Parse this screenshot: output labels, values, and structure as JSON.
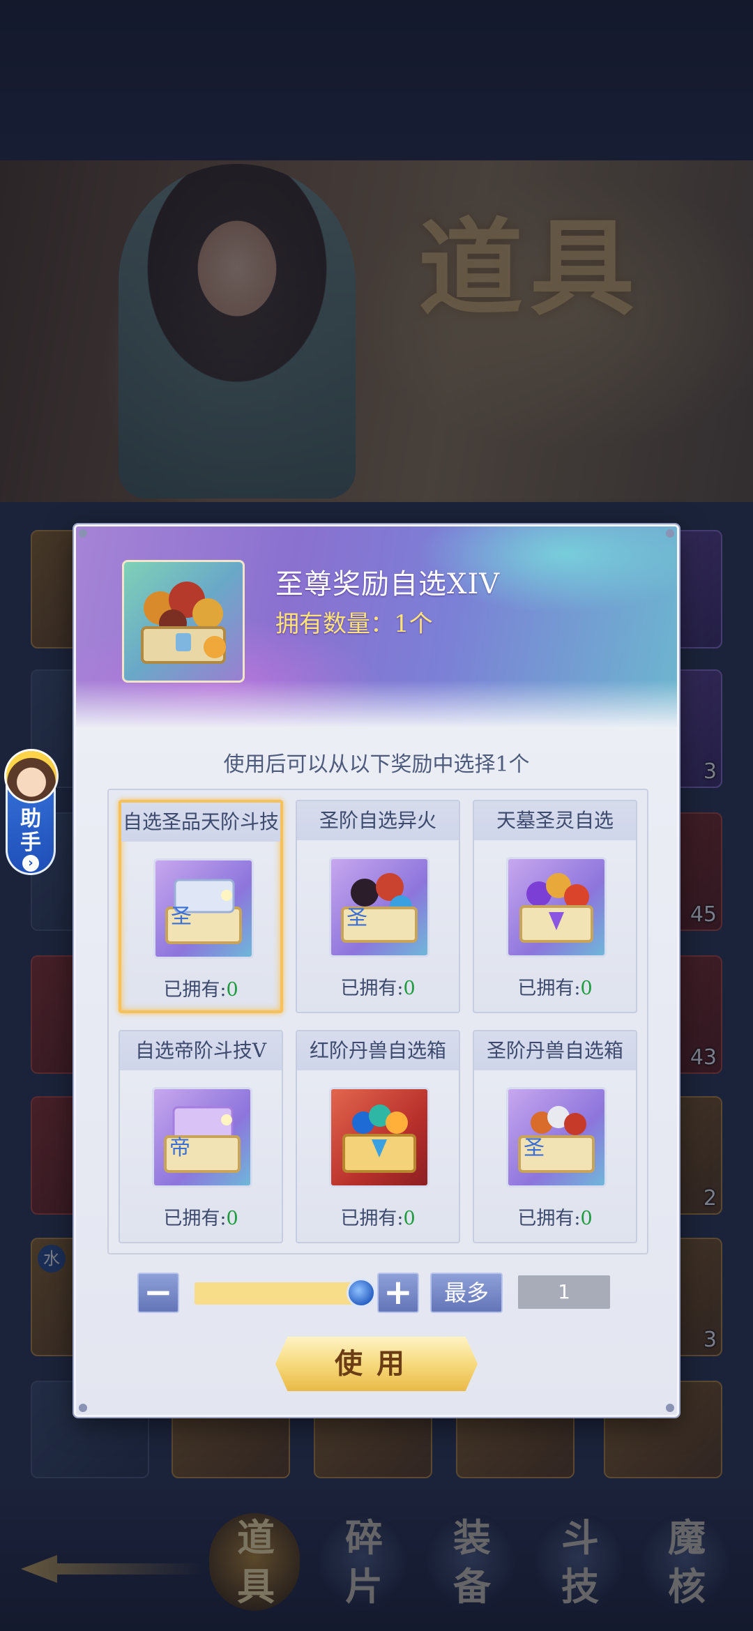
{
  "background": {
    "banner_title": "道具",
    "bottom_tabs": [
      {
        "line1": "道",
        "line2": "具",
        "active": true
      },
      {
        "line1": "碎",
        "line2": "片",
        "active": false
      },
      {
        "line1": "装",
        "line2": "备",
        "active": false
      },
      {
        "line1": "斗",
        "line2": "技",
        "active": false
      },
      {
        "line1": "魔",
        "line2": "核",
        "active": false
      }
    ],
    "visible_counts": [
      "3",
      "45",
      "43",
      "2",
      "3"
    ],
    "element_badge": "水"
  },
  "helper": {
    "label_line1": "助",
    "label_line2": "手"
  },
  "dialog": {
    "item_name": "至尊奖励自选XIV",
    "owned_label": "拥有数量：",
    "owned_value": "1个",
    "description": "使用后可以从以下奖励中选择1个",
    "options": [
      {
        "title": "自选圣品天阶斗技",
        "owned_prefix": "已拥有:",
        "owned_count": "0",
        "icon": "scroll-chest-icon",
        "selected": true
      },
      {
        "title": "圣阶自选异火",
        "owned_prefix": "已拥有:",
        "owned_count": "0",
        "icon": "fire-chest-icon",
        "selected": false
      },
      {
        "title": "天墓圣灵自选",
        "owned_prefix": "已拥有:",
        "owned_count": "0",
        "icon": "spirit-chest-icon",
        "selected": false
      },
      {
        "title": "自选帝阶斗技V",
        "owned_prefix": "已拥有:",
        "owned_count": "0",
        "icon": "emperor-scroll-chest-icon",
        "selected": false
      },
      {
        "title": "红阶丹兽自选箱",
        "owned_prefix": "已拥有:",
        "owned_count": "0",
        "icon": "red-beast-chest-icon",
        "selected": false
      },
      {
        "title": "圣阶丹兽自选箱",
        "owned_prefix": "已拥有:",
        "owned_count": "0",
        "icon": "holy-beast-chest-icon",
        "selected": false
      }
    ],
    "quantity": {
      "minus_label": "−",
      "plus_label": "+",
      "max_label": "最多",
      "value": "1",
      "slider_fraction": 1.0
    },
    "use_label": "使用"
  },
  "colors": {
    "accent_gold": "#f4c15c",
    "owned_green": "#1f9b3f",
    "title_yellow": "#ffe27a"
  }
}
